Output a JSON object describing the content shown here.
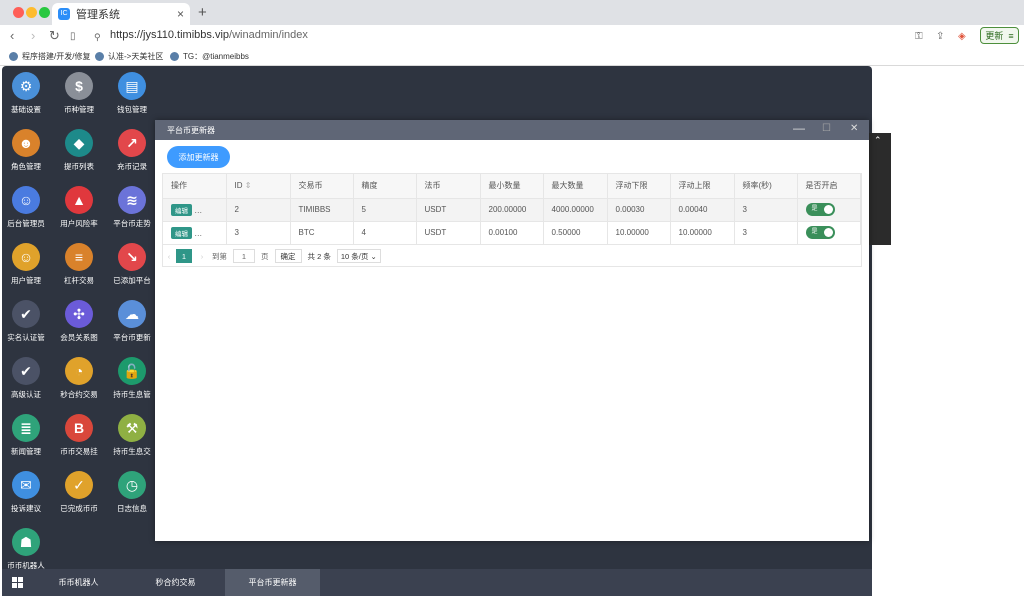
{
  "browser": {
    "tab_title": "管理系统",
    "tab_favicon": "IC",
    "url_host": "https://jys110.timibbs.vip",
    "url_path": "/winadmin/index",
    "update_button": "更新",
    "bookmarks": [
      "程序搭建/开发/修复",
      "认准->天美社区",
      "TG：@tianmeibbs"
    ],
    "traffic_colors": [
      "#ff5f57",
      "#febc2e",
      "#28c840"
    ]
  },
  "desktop_icons": [
    {
      "label": "基础设置",
      "icon": "gear-icon",
      "color": "#4a90d9",
      "glyph": "⚙"
    },
    {
      "label": "币种管理",
      "icon": "dollar-icon",
      "color": "#8a8f98",
      "glyph": "$"
    },
    {
      "label": "钱包管理",
      "icon": "wallet-icon",
      "color": "#3f8fe0",
      "glyph": "▤"
    },
    {
      "label": "角色管理",
      "icon": "roles-icon",
      "color": "#d9822b",
      "glyph": "☻"
    },
    {
      "label": "提币列表",
      "icon": "withdraw-icon",
      "color": "#1d8a8a",
      "glyph": "◆"
    },
    {
      "label": "充币记录",
      "icon": "deposit-icon",
      "color": "#e2474b",
      "glyph": "↗"
    },
    {
      "label": "后台管理员",
      "icon": "admin-icon",
      "color": "#4a7be0",
      "glyph": "☺"
    },
    {
      "label": "用户风险率",
      "icon": "alarm-icon",
      "color": "#e0383d",
      "glyph": "▲"
    },
    {
      "label": "平台币走势",
      "icon": "layers-icon",
      "color": "#6b73d9",
      "glyph": "≋"
    },
    {
      "label": "用户管理",
      "icon": "user-search-icon",
      "color": "#e0a22b",
      "glyph": "☺"
    },
    {
      "label": "杠杆交易",
      "icon": "stack-icon",
      "color": "#d9822b",
      "glyph": "≡"
    },
    {
      "label": "已添加平台",
      "icon": "trend-icon",
      "color": "#e2474b",
      "glyph": "↘"
    },
    {
      "label": "实名认证管",
      "icon": "verify-icon",
      "color": "#4b5266",
      "glyph": "✔"
    },
    {
      "label": "会员关系图",
      "icon": "network-icon",
      "color": "#6b5bd9",
      "glyph": "✣"
    },
    {
      "label": "平台币更新",
      "icon": "cloud-sync-icon",
      "color": "#5a8fd9",
      "glyph": "☁"
    },
    {
      "label": "高级认证",
      "icon": "advanced-verify-icon",
      "color": "#4b5266",
      "glyph": "✔"
    },
    {
      "label": "秒合约交易",
      "icon": "timer-icon",
      "color": "#e0a22b",
      "glyph": "◔"
    },
    {
      "label": "持币生息管",
      "icon": "unlock-icon",
      "color": "#1d9a6c",
      "glyph": "🔓"
    },
    {
      "label": "新闻管理",
      "icon": "news-icon",
      "color": "#2fa37a",
      "glyph": "≣"
    },
    {
      "label": "币币交易挂",
      "icon": "bitcoin-bag-icon",
      "color": "#d9473b",
      "glyph": "B"
    },
    {
      "label": "持币生息交",
      "icon": "hammer-icon",
      "color": "#8fb043",
      "glyph": "⚒"
    },
    {
      "label": "投诉建议",
      "icon": "complaint-icon",
      "color": "#3f8fe0",
      "glyph": "✉"
    },
    {
      "label": "已完成币币",
      "icon": "done-icon",
      "color": "#e0a22b",
      "glyph": "✓"
    },
    {
      "label": "日志信息",
      "icon": "log-icon",
      "color": "#2fa37a",
      "glyph": "◷"
    },
    {
      "label": "币币机器人",
      "icon": "robot-icon",
      "color": "#2fa37a",
      "glyph": "☗"
    }
  ],
  "window": {
    "title": "平台币更新器",
    "add_button": "添加更新器",
    "columns": [
      "操作",
      "ID",
      "交易币",
      "精度",
      "法币",
      "最小数量",
      "最大数量",
      "浮动下限",
      "浮动上限",
      "频率(秒)",
      "是否开启"
    ],
    "edit_label": "编辑",
    "toggle_on": "是",
    "rows": [
      [
        "2",
        "TIMIBBS",
        "5",
        "USDT",
        "200.00000",
        "4000.00000",
        "0.00030",
        "0.00040",
        "3"
      ],
      [
        "3",
        "BTC",
        "4",
        "USDT",
        "0.00100",
        "0.50000",
        "10.00000",
        "10.00000",
        "3"
      ]
    ],
    "pager": {
      "current": "1",
      "goto_label": "到第",
      "goto_value": "1",
      "page_unit": "页",
      "confirm": "确定",
      "total": "共 2 条",
      "per_page": "10 条/页"
    }
  },
  "taskbar": {
    "tasks": [
      "币币机器人",
      "秒合约交易",
      "平台币更新器"
    ],
    "active_index": 2
  }
}
